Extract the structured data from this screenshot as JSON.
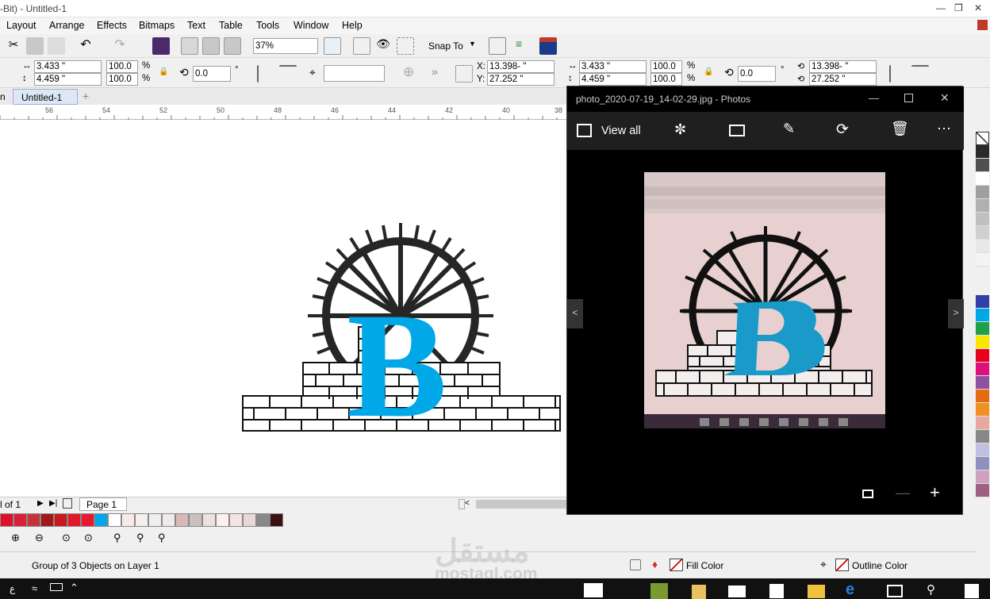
{
  "title": {
    "text": "-Bit) - Untitled-1"
  },
  "menu": [
    "Layout",
    "Arrange",
    "Effects",
    "Bitmaps",
    "Text",
    "Table",
    "Tools",
    "Window",
    "Help"
  ],
  "toolbar": {
    "zoom": "37%",
    "snap_to": "Snap To"
  },
  "props": {
    "width": "3.433 \"",
    "height": "4.459 \"",
    "scale_w": "100.0",
    "scale_h": "100.0",
    "percent": "%",
    "rotation": "0.0",
    "degree": "°",
    "x_label": "X:",
    "y_label": "Y:",
    "x": "13.398- \"",
    "y": "27.252 \""
  },
  "doc": {
    "tab1": "n",
    "tab2": "Untitled-1",
    "add": "+"
  },
  "ruler": {
    "ticks": [
      "56",
      "54",
      "52",
      "50",
      "48",
      "46",
      "44",
      "42",
      "40",
      "38"
    ]
  },
  "pagenav": {
    "count": "l of 1",
    "page": "Page 1"
  },
  "palette": {
    "bottom": [
      "#e0102a",
      "#d8223a",
      "#c8323a",
      "#a01818",
      "#c81820",
      "#e01828",
      "#e81830",
      "#00a8e8",
      "#ffffff",
      "#fbe8e8",
      "#f4f0f0",
      "#eeeeee",
      "#f0eaea",
      "#d8b8b8",
      "#c8c0c0",
      "#ece0e0",
      "#fff0f0",
      "#f4e4e4",
      "#e8d8d8",
      "#888888",
      "#3a1010"
    ],
    "right": [
      "#ffffff",
      "#2a2a2a",
      "#505050",
      "#ffffff",
      "#a0a0a0",
      "#b0b0b0",
      "#c0c0c0",
      "#d0d0d0",
      "#e8e8e8",
      "#f4f4f4",
      "#3040a8",
      "#00a8e8",
      "#20a048",
      "#f8e800",
      "#e8001c",
      "#e0107a",
      "#9050a0",
      "#e86a10",
      "#f09020",
      "#e8a8a0",
      "#888888",
      "#c0c0e0",
      "#9090c0",
      "#d0a0c0",
      "#a06080"
    ]
  },
  "status": {
    "selection": "Group of 3 Objects on Layer 1",
    "fill": "Fill Color",
    "outline": "Outline Color"
  },
  "photos": {
    "title": "photo_2020-07-19_14-02-29.jpg - Photos",
    "view_all": "View all",
    "icons": [
      "enhance-icon",
      "slideshow-icon",
      "edit-icon",
      "rotate-icon",
      "delete-icon",
      "more-icon"
    ]
  },
  "logo": {
    "letter": "B",
    "letter_color": "#00a8e8",
    "watermark_text": "mostaql.com"
  }
}
